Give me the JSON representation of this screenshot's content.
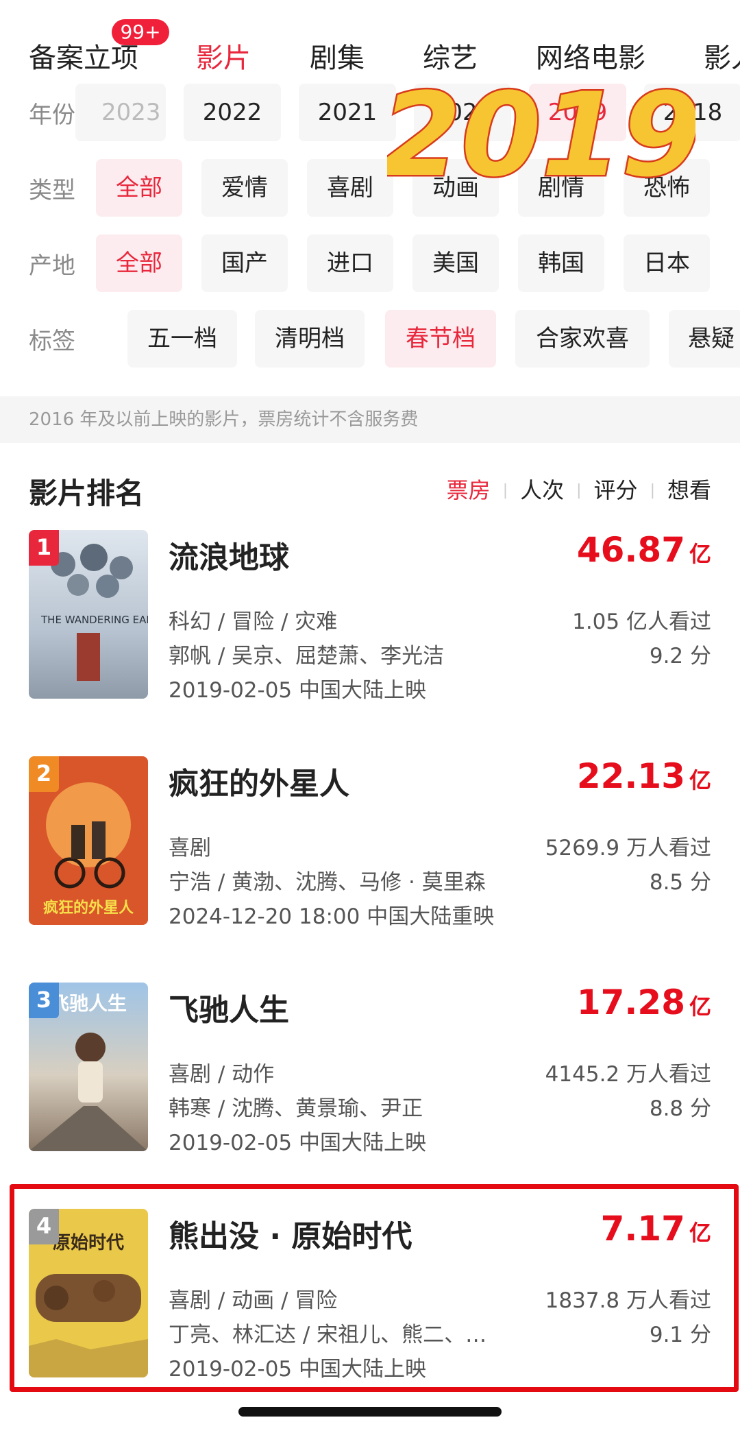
{
  "top_tabs": [
    {
      "label": "备案立项",
      "badge": "99+"
    },
    {
      "label": "影片"
    },
    {
      "label": "剧集"
    },
    {
      "label": "综艺"
    },
    {
      "label": "网络电影"
    },
    {
      "label": "影人"
    }
  ],
  "active_tab": "影片",
  "overlay_year": "2019",
  "filters": {
    "year": {
      "label": "年份",
      "options": [
        "2023",
        "2022",
        "2021",
        "2020",
        "2019",
        "2018"
      ]
    },
    "type": {
      "label": "类型",
      "options": [
        "全部",
        "爱情",
        "喜剧",
        "动画",
        "剧情",
        "恐怖"
      ],
      "selected": "全部"
    },
    "region": {
      "label": "产地",
      "options": [
        "全部",
        "国产",
        "进口",
        "美国",
        "韩国",
        "日本"
      ],
      "selected": "全部"
    },
    "tag": {
      "label": "标签",
      "options": [
        "五一档",
        "清明档",
        "春节档",
        "合家欢喜",
        "悬疑"
      ],
      "selected": "春节档"
    }
  },
  "notice": "2016 年及以前上映的影片，票房统计不含服务费",
  "ranking": {
    "title": "影片排名",
    "sorts": [
      "票房",
      "人次",
      "评分",
      "想看"
    ],
    "active_sort": "票房",
    "movies": [
      {
        "rank": "1",
        "name": "流浪地球",
        "box_office": "46.87",
        "unit": "亿",
        "genres": "科幻 / 冒险 / 灾难",
        "viewers": "1.05 亿人看过",
        "credits": "郭帆 / 吴京、屈楚萧、李光洁",
        "score": "9.2 分",
        "release": "2019-02-05 中国大陆上映",
        "poster_title": "THE WANDERING EARTH"
      },
      {
        "rank": "2",
        "name": "疯狂的外星人",
        "box_office": "22.13",
        "unit": "亿",
        "genres": "喜剧",
        "viewers": "5269.9 万人看过",
        "credits": "宁浩 / 黄渤、沈腾、马修 · 莫里森",
        "score": "8.5 分",
        "release": "2024-12-20 18:00 中国大陆重映",
        "poster_title": "疯狂的外星人"
      },
      {
        "rank": "3",
        "name": "飞驰人生",
        "box_office": "17.28",
        "unit": "亿",
        "genres": "喜剧 / 动作",
        "viewers": "4145.2 万人看过",
        "credits": "韩寒 / 沈腾、黄景瑜、尹正",
        "score": "8.8 分",
        "release": "2019-02-05 中国大陆上映",
        "poster_title": "飞驰人生"
      },
      {
        "rank": "4",
        "name": "熊出没 · 原始时代",
        "box_office": "7.17",
        "unit": "亿",
        "genres": "喜剧 / 动画 / 冒险",
        "viewers": "1837.8 万人看过",
        "credits": "丁亮、林汇达 / 宋祖儿、熊二、…",
        "score": "9.1 分",
        "release": "2019-02-05 中国大陆上映",
        "poster_title": "原始时代"
      }
    ]
  },
  "colors": {
    "accent": "#e8273c",
    "box_office": "#e60e1c",
    "rank_1": "#e8273c",
    "rank_2": "#f08a24",
    "rank_3": "#4a8ed8",
    "rank_4": "#9a9a9a",
    "highlight": "#e40a12",
    "overlay_fill": "#f7c531",
    "overlay_stroke": "#d83a1c"
  }
}
